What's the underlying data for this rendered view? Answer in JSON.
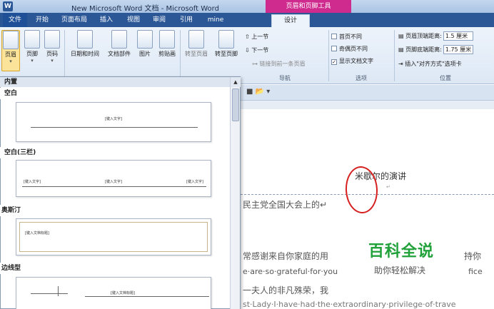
{
  "window": {
    "app_icon": "W",
    "title": "New Microsoft Word 文档 - Microsoft Word",
    "context_tool_title": "页眉和页脚工具"
  },
  "tabs": [
    "文件",
    "开始",
    "页面布局",
    "插入",
    "视图",
    "审阅",
    "引用",
    "mine",
    "设计"
  ],
  "ribbon": {
    "buttons": [
      {
        "label": "页眉",
        "icon": "header-page-icon"
      },
      {
        "label": "页脚",
        "icon": "footer-page-icon"
      },
      {
        "label": "页码",
        "icon": "page-number-icon"
      },
      {
        "label": "日期和时间",
        "icon": "calendar-icon"
      },
      {
        "label": "文档部件",
        "icon": "quick-parts-icon"
      },
      {
        "label": "图片",
        "icon": "picture-icon"
      },
      {
        "label": "剪贴画",
        "icon": "clipart-icon"
      },
      {
        "label": "转至页眉",
        "icon": "goto-header-icon"
      },
      {
        "label": "转至页脚",
        "icon": "goto-footer-icon"
      }
    ],
    "nav_prev": "上一节",
    "nav_next": "下一节",
    "link_prev": "链接到前一条页眉",
    "options": [
      {
        "label": "首页不同",
        "checked": false
      },
      {
        "label": "奇偶页不同",
        "checked": false
      },
      {
        "label": "显示文档文字",
        "checked": true
      }
    ],
    "position": {
      "header_label": "页眉顶端距离:",
      "header_value": "1.5 厘米",
      "footer_label": "页脚底端距离:",
      "footer_value": "1.75 厘米",
      "insert_align": "插入\"对齐方式\"选项卡"
    },
    "groups": {
      "nav": "导航",
      "options": "选项",
      "position": "位置"
    }
  },
  "gallery": {
    "builtin": "内置",
    "sections": [
      "空白",
      "空白(三栏)",
      "奥斯汀",
      "边线型"
    ],
    "placeholders": {
      "blank": "[键入文字]",
      "three": [
        "[键入文字]",
        "[键入文字]",
        "[键入文字]"
      ],
      "austin": "[键入文档标题]",
      "border": "[键入文档标题]"
    }
  },
  "document": {
    "header_text": "米歇尔的演讲",
    "header_mark": "↵",
    "lines": [
      "民主党全国大会上的↵",
      "常感谢来自你家庭的用",
      "e·are·so·grateful·for·you",
      "一夫人的非凡殊荣，我"
    ],
    "line4_tail": "st·Lady·I·have·had·the·extraordinary·privilege·of·trave",
    "right_fragments": [
      "持你",
      "fice"
    ]
  },
  "watermark": {
    "title": "百科全说",
    "subtitle": "助你轻松解决"
  },
  "colors": {
    "tab_bar": "#2b5797",
    "context_tab": "#cf2a8e",
    "watermark": "#21a139",
    "annotation": "#d62020"
  }
}
